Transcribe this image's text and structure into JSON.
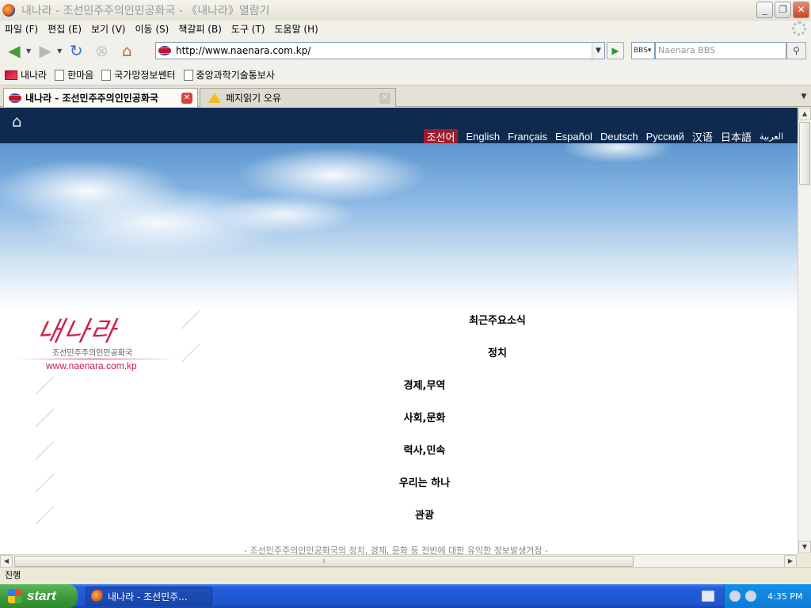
{
  "window": {
    "title": "내나라 - 조선민주주의인민공화국 - 《내나라》열람기"
  },
  "menubar": {
    "items": [
      "파일 (F)",
      "편집 (E)",
      "보기 (V)",
      "이동 (S)",
      "책갈피 (B)",
      "도구 (T)",
      "도움말 (H)"
    ]
  },
  "toolbar": {
    "url": "http://www.naenara.com.kp/",
    "search_engine": "BBS",
    "search_placeholder": "Naenara BBS"
  },
  "bookmarks": [
    "내나라",
    "한마음",
    "국가망정보쎈터",
    "중앙과학기술통보사"
  ],
  "tabs": [
    {
      "label": "내나라 - 조선민주주의인민공화국"
    },
    {
      "label": "페지읽기 오유"
    }
  ],
  "site": {
    "languages": [
      "조선어",
      "English",
      "Français",
      "Español",
      "Deutsch",
      "Русский",
      "汉语",
      "日本語",
      "العربية"
    ],
    "logo_script": "내나라",
    "logo_subtitle": "조선민주주의인민공화국",
    "logo_url": "www.naenara.com.kp",
    "menu": [
      "최근주요소식",
      "정치",
      "경제,무역",
      "사회,문화",
      "력사,민속",
      "우리는 하나",
      "관광"
    ],
    "footer_note": "- 조선민주주의인민공화국의 정치, 경제, 문화 등 전반에 대한 유익한 정보발생거점 -"
  },
  "status": {
    "text": "진행"
  },
  "taskbar": {
    "start_label": "start",
    "task_label": "내나라 - 조선민주...",
    "clock": "4:35 PM"
  }
}
